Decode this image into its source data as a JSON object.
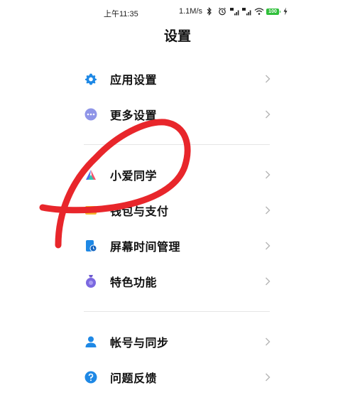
{
  "status_bar": {
    "time": "上午11:35",
    "speed": "1.1M/s",
    "battery": "100"
  },
  "page": {
    "title": "设置"
  },
  "groups": [
    {
      "items": [
        {
          "label": "应用设置",
          "icon": "gear-icon"
        },
        {
          "label": "更多设置",
          "icon": "more-icon"
        }
      ]
    },
    {
      "items": [
        {
          "label": "小爱同学",
          "icon": "xiaoai-icon"
        },
        {
          "label": "钱包与支付",
          "icon": "wallet-icon"
        },
        {
          "label": "屏幕时间管理",
          "icon": "screen-time-icon"
        },
        {
          "label": "特色功能",
          "icon": "features-icon"
        }
      ]
    },
    {
      "items": [
        {
          "label": "帐号与同步",
          "icon": "account-icon"
        },
        {
          "label": "问题反馈",
          "icon": "feedback-icon"
        }
      ]
    }
  ],
  "colors": {
    "accent_blue": "#1e88e5",
    "annotation_red": "#e8262b",
    "battery_green": "#2fbf3a",
    "chevron": "#b5b5b5"
  }
}
